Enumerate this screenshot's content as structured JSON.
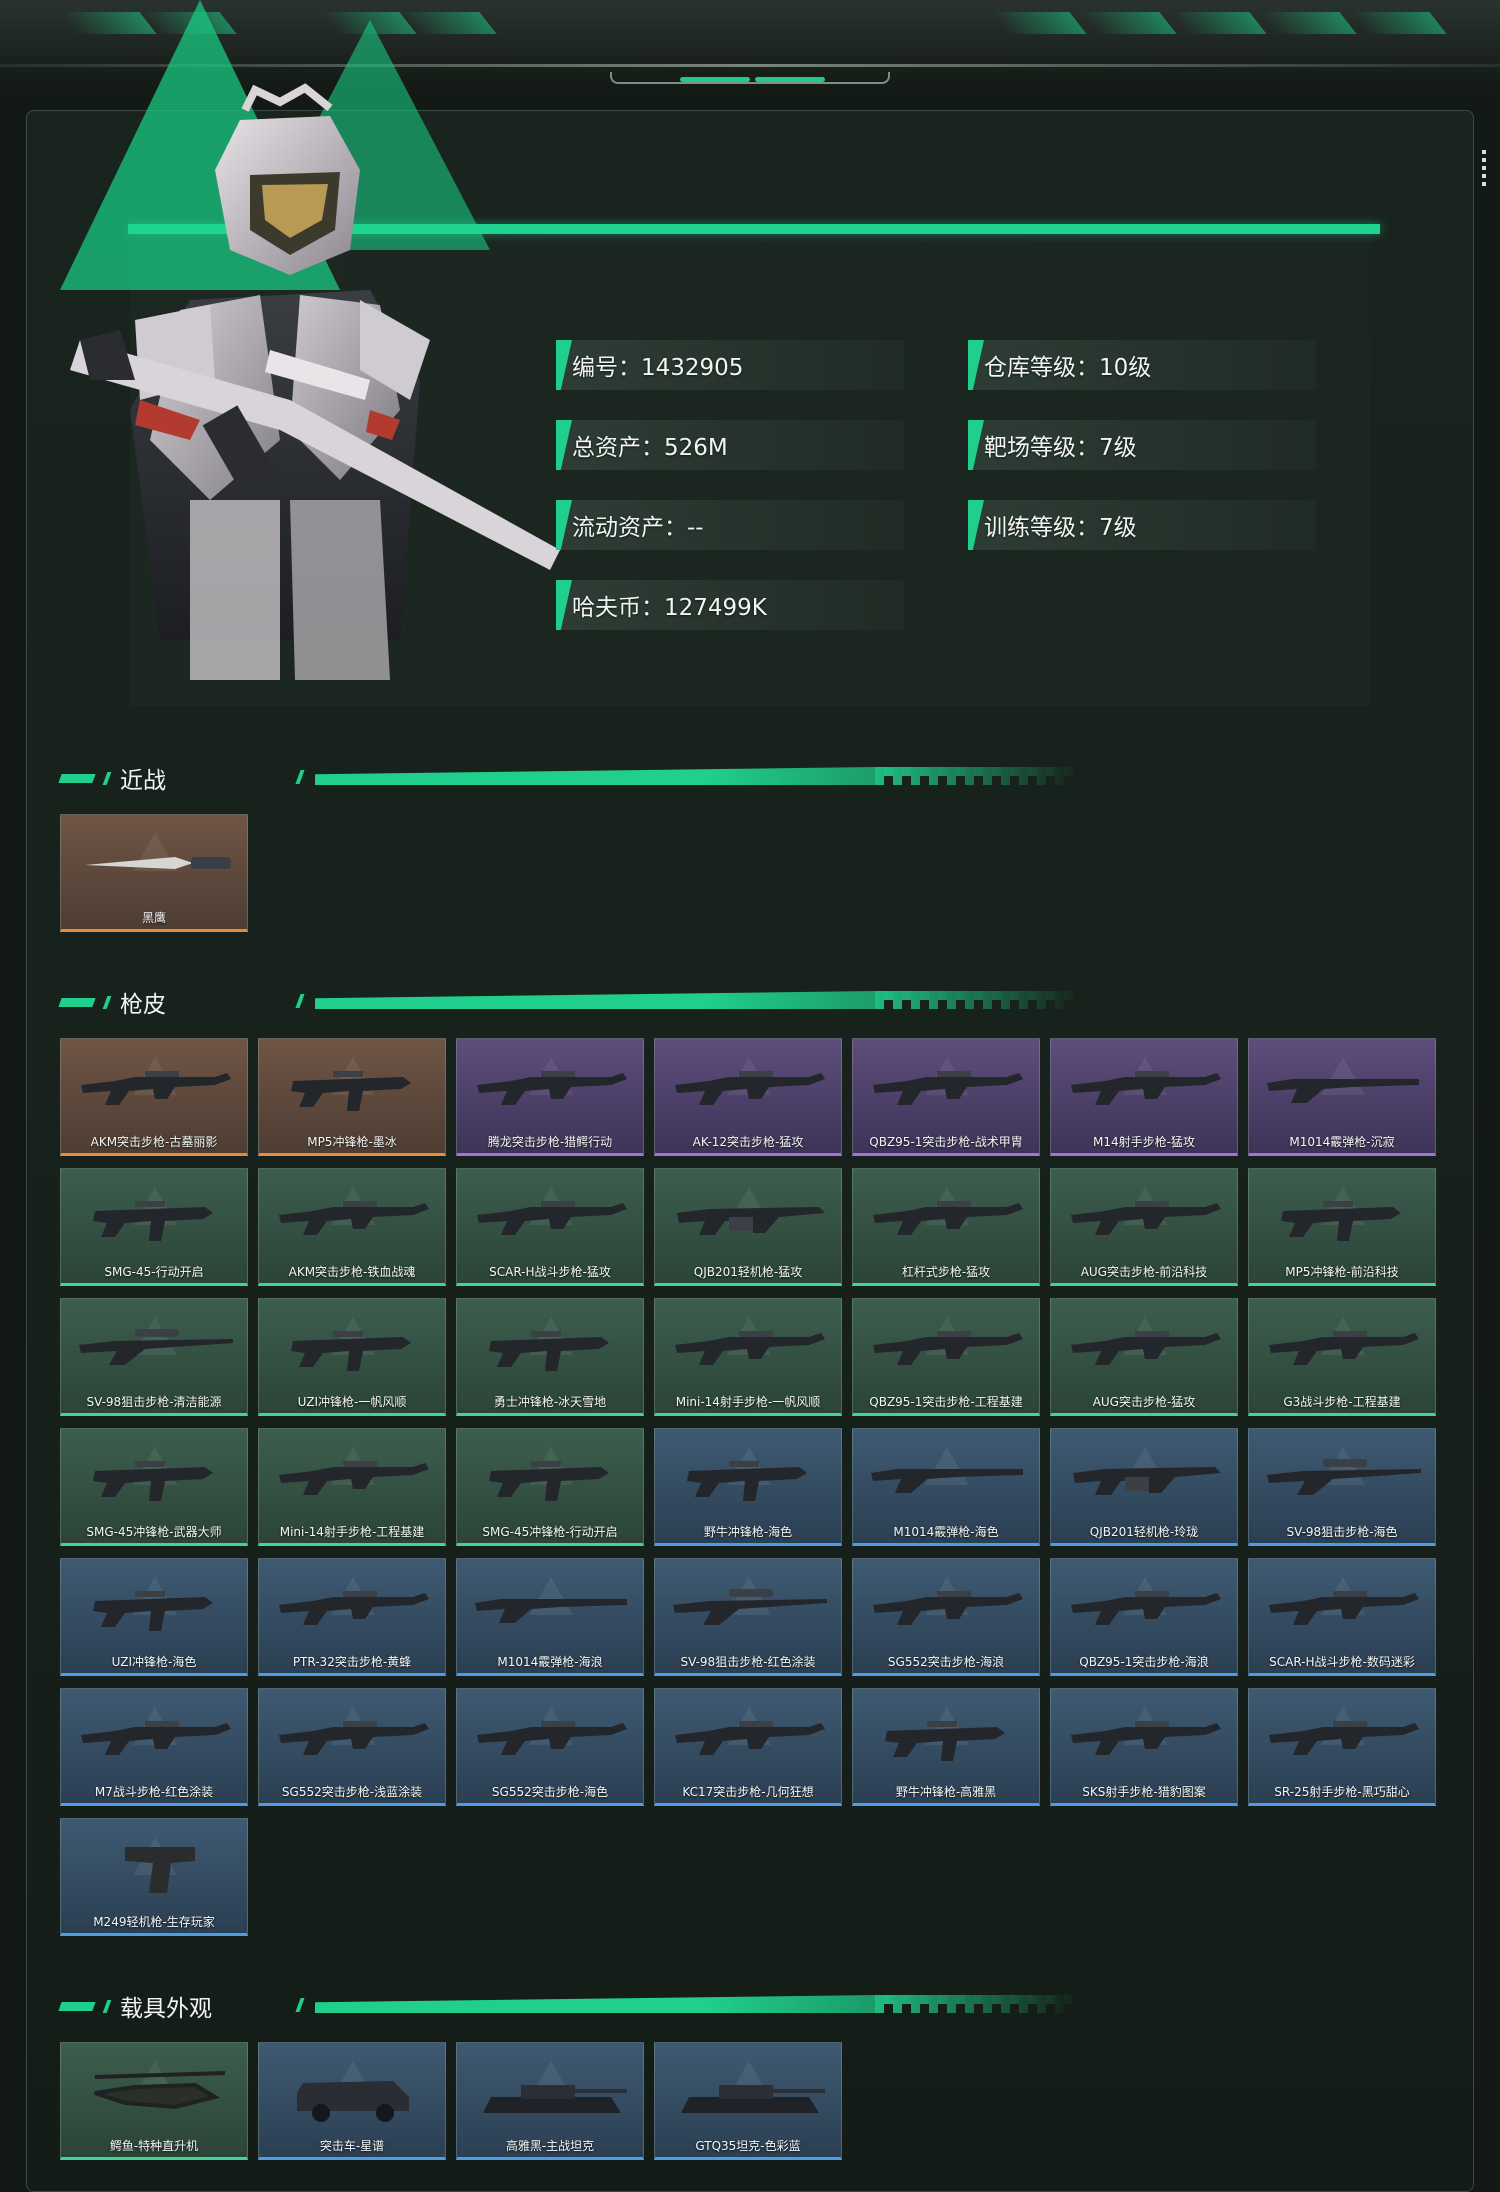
{
  "profile": {
    "stats": [
      {
        "label": "编号",
        "value": "1432905"
      },
      {
        "label": "仓库等级",
        "value": "10级"
      },
      {
        "label": "总资产",
        "value": "526M"
      },
      {
        "label": "靶场等级",
        "value": "7级"
      },
      {
        "label": "流动资产",
        "value": "--"
      },
      {
        "label": "训练等级",
        "value": "7级"
      },
      {
        "label": "哈夫币",
        "value": "127499K"
      }
    ],
    "stat_text": [
      "编号：1432905",
      "仓库等级：10级",
      "总资产：526M",
      "靶场等级：7级",
      "流动资产：--",
      "训练等级：7级",
      "哈夫币：127499K"
    ]
  },
  "colors": {
    "accent": "#1fcf8b",
    "quality_orange": "#e98a3c",
    "quality_purple": "#9d74d8",
    "quality_green": "#3fd693",
    "quality_blue": "#4c9ce8"
  },
  "sections": {
    "melee": {
      "title": "近战",
      "items": [
        {
          "name": "黑鹰",
          "quality": "orange",
          "icon": "knife-icon"
        }
      ]
    },
    "gun_skins": {
      "title": "枪皮",
      "items": [
        {
          "name": "AKM突击步枪-古墓丽影",
          "quality": "orange",
          "icon": "rifle-icon"
        },
        {
          "name": "MP5冲锋枪-墨冰",
          "quality": "orange",
          "icon": "smg-icon"
        },
        {
          "name": "腾龙突击步枪-猎鳄行动",
          "quality": "purple",
          "icon": "rifle-icon"
        },
        {
          "name": "AK-12突击步枪-猛攻",
          "quality": "purple",
          "icon": "rifle-icon"
        },
        {
          "name": "QBZ95-1突击步枪-战术甲胄",
          "quality": "purple",
          "icon": "rifle-icon"
        },
        {
          "name": "M14射手步枪-猛攻",
          "quality": "purple",
          "icon": "rifle-icon"
        },
        {
          "name": "M1014霰弹枪-沉寂",
          "quality": "purple",
          "icon": "shotgun-icon"
        },
        {
          "name": "SMG-45-行动开启",
          "quality": "green",
          "icon": "smg-icon"
        },
        {
          "name": "AKM突击步枪-铁血战魂",
          "quality": "green",
          "icon": "rifle-icon"
        },
        {
          "name": "SCAR-H战斗步枪-猛攻",
          "quality": "green",
          "icon": "rifle-icon"
        },
        {
          "name": "QJB201轻机枪-猛攻",
          "quality": "green",
          "icon": "lmg-icon"
        },
        {
          "name": "杠杆式步枪-猛攻",
          "quality": "green",
          "icon": "rifle-icon"
        },
        {
          "name": "AUG突击步枪-前沿科技",
          "quality": "green",
          "icon": "rifle-icon"
        },
        {
          "name": "MP5冲锋枪-前沿科技",
          "quality": "green",
          "icon": "smg-icon"
        },
        {
          "name": "SV-98狙击步枪-清洁能源",
          "quality": "green",
          "icon": "sniper-icon"
        },
        {
          "name": "UZI冲锋枪-一帆风顺",
          "quality": "green",
          "icon": "smg-icon"
        },
        {
          "name": "勇士冲锋枪-冰天雪地",
          "quality": "green",
          "icon": "smg-icon"
        },
        {
          "name": "Mini-14射手步枪-一帆风顺",
          "quality": "green",
          "icon": "rifle-icon"
        },
        {
          "name": "QBZ95-1突击步枪-工程基建",
          "quality": "green",
          "icon": "rifle-icon"
        },
        {
          "name": "AUG突击步枪-猛攻",
          "quality": "green",
          "icon": "rifle-icon"
        },
        {
          "name": "G3战斗步枪-工程基建",
          "quality": "green",
          "icon": "rifle-icon"
        },
        {
          "name": "SMG-45冲锋枪-武器大师",
          "quality": "green",
          "icon": "smg-icon"
        },
        {
          "name": "Mini-14射手步枪-工程基建",
          "quality": "green",
          "icon": "rifle-icon"
        },
        {
          "name": "SMG-45冲锋枪-行动开启",
          "quality": "green",
          "icon": "smg-icon"
        },
        {
          "name": "野牛冲锋枪-海色",
          "quality": "blue",
          "icon": "smg-icon"
        },
        {
          "name": "M1014霰弹枪-海色",
          "quality": "blue",
          "icon": "shotgun-icon"
        },
        {
          "name": "QJB201轻机枪-玲珑",
          "quality": "blue",
          "icon": "lmg-icon"
        },
        {
          "name": "SV-98狙击步枪-海色",
          "quality": "blue",
          "icon": "sniper-icon"
        },
        {
          "name": "UZI冲锋枪-海色",
          "quality": "blue",
          "icon": "smg-icon"
        },
        {
          "name": "PTR-32突击步枪-黄蜂",
          "quality": "blue",
          "icon": "rifle-icon"
        },
        {
          "name": "M1014霰弹枪-海浪",
          "quality": "blue",
          "icon": "shotgun-icon"
        },
        {
          "name": "SV-98狙击步枪-红色涂装",
          "quality": "blue",
          "icon": "sniper-icon"
        },
        {
          "name": "SG552突击步枪-海浪",
          "quality": "blue",
          "icon": "rifle-icon"
        },
        {
          "name": "QBZ95-1突击步枪-海浪",
          "quality": "blue",
          "icon": "rifle-icon"
        },
        {
          "name": "SCAR-H战斗步枪-数码迷彩",
          "quality": "blue",
          "icon": "rifle-icon"
        },
        {
          "name": "M7战斗步枪-红色涂装",
          "quality": "blue",
          "icon": "rifle-icon"
        },
        {
          "name": "SG552突击步枪-浅蓝涂装",
          "quality": "blue",
          "icon": "rifle-icon"
        },
        {
          "name": "SG552突击步枪-海色",
          "quality": "blue",
          "icon": "rifle-icon"
        },
        {
          "name": "KC17突击步枪-几何狂想",
          "quality": "blue",
          "icon": "rifle-icon"
        },
        {
          "name": "野牛冲锋枪-高雅黑",
          "quality": "blue",
          "icon": "smg-icon"
        },
        {
          "name": "SKS射手步枪-猎豹图案",
          "quality": "blue",
          "icon": "rifle-icon"
        },
        {
          "name": "SR-25射手步枪-黑巧甜心",
          "quality": "blue",
          "icon": "rifle-icon"
        },
        {
          "name": "M249轻机枪-生存玩家",
          "quality": "blue",
          "icon": "pistol-icon"
        }
      ]
    },
    "vehicles": {
      "title": "载具外观",
      "items": [
        {
          "name": "鳄鱼-特种直升机",
          "quality": "green",
          "icon": "helicopter-icon"
        },
        {
          "name": "突击车-星谱",
          "quality": "blue",
          "icon": "armored-car-icon"
        },
        {
          "name": "高雅黑-主战坦克",
          "quality": "blue",
          "icon": "tank-icon"
        },
        {
          "name": "GTQ35坦克-色彩蓝",
          "quality": "blue",
          "icon": "tank-icon"
        }
      ]
    }
  }
}
